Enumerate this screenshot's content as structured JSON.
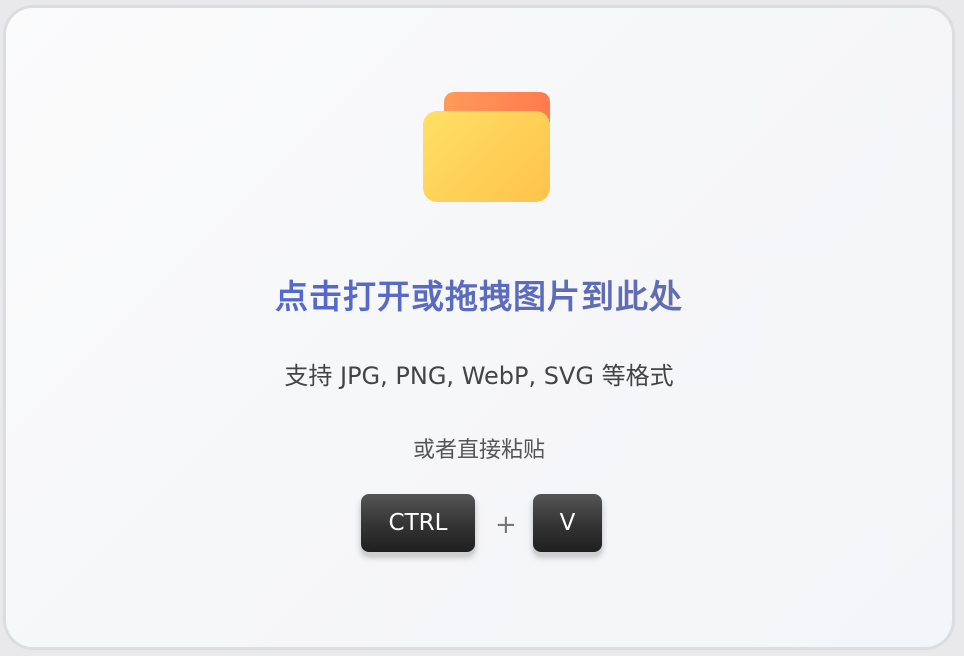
{
  "dropzone": {
    "title": "点击打开或拖拽图片到此处",
    "subtitle": "支持 JPG, PNG, WebP, SVG 等格式",
    "paste_hint": "或者直接粘贴",
    "folder_icon": "folder-icon"
  },
  "shortcut": {
    "key1": "CTRL",
    "separator": "+",
    "key2": "V"
  },
  "colors": {
    "title_gradient_start": "#4a63e6",
    "title_gradient_end": "#6a7196",
    "folder_yellow": "#ffd257",
    "folder_tab_orange": "#ff7a4f",
    "key_dark": "#333333"
  }
}
